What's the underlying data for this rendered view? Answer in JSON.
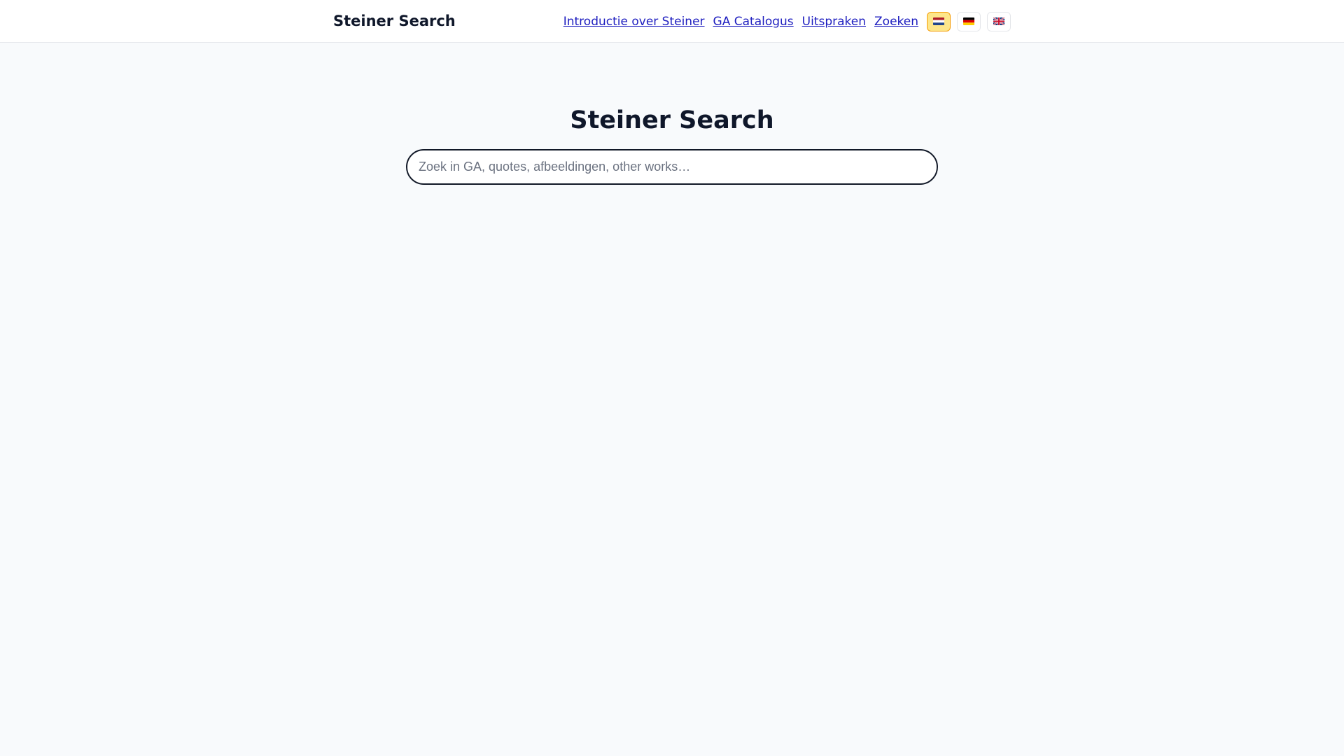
{
  "header": {
    "brand": "Steiner Search",
    "nav": [
      {
        "label": "Introductie over Steiner"
      },
      {
        "label": "GA Catalogus"
      },
      {
        "label": "Uitspraken"
      },
      {
        "label": "Zoeken"
      }
    ],
    "languages": [
      {
        "code": "nl",
        "icon": "netherlands-flag-icon",
        "active": true
      },
      {
        "code": "de",
        "icon": "germany-flag-icon",
        "active": false
      },
      {
        "code": "en",
        "icon": "uk-flag-icon",
        "active": false
      }
    ]
  },
  "main": {
    "title": "Steiner Search",
    "search": {
      "value": "",
      "placeholder": "Zoek in GA, quotes, afbeeldingen, other works…"
    }
  },
  "colors": {
    "background": "#f8fafc",
    "link": "#1d1dbf",
    "active_language": "#fde68a",
    "text": "#0f172a"
  }
}
